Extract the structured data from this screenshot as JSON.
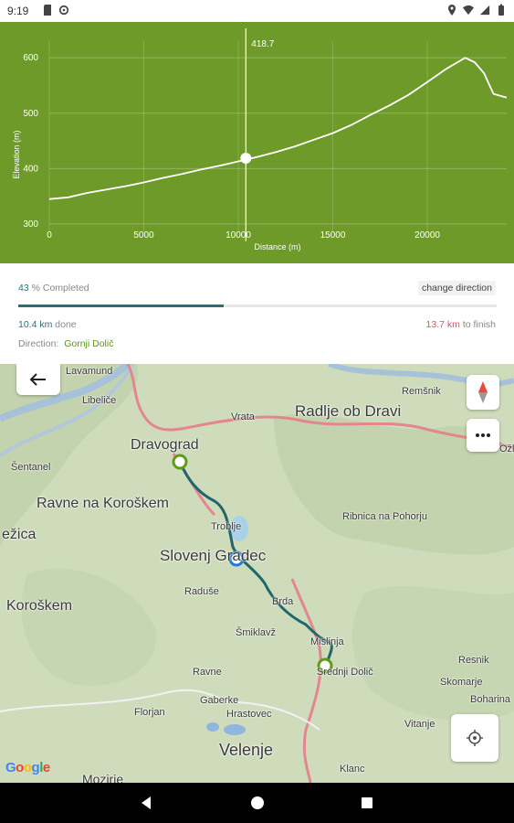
{
  "status_bar": {
    "time": "9:19"
  },
  "elevation_chart": {
    "cursor_label": "418.7",
    "ylabel": "Elevation (m)",
    "xlabel": "Distance (m)",
    "y_ticks": [
      "600",
      "500",
      "400",
      "300"
    ],
    "x_ticks": [
      "0",
      "5000",
      "10000",
      "15000",
      "20000"
    ]
  },
  "chart_data": {
    "type": "area",
    "xlabel": "Distance (m)",
    "ylabel": "Elevation (m)",
    "xlim": [
      0,
      24200
    ],
    "ylim": [
      285,
      630
    ],
    "grid": true,
    "cursor": {
      "x": 10400,
      "y": 418.7
    },
    "x": [
      0,
      1000,
      2000,
      3000,
      4000,
      5000,
      6000,
      7000,
      8000,
      9000,
      10000,
      11000,
      12000,
      13000,
      14000,
      15000,
      16000,
      17000,
      18000,
      19000,
      20000,
      21000,
      22000,
      22500,
      23000,
      23500,
      24200
    ],
    "values": [
      345,
      348,
      356,
      362,
      368,
      375,
      383,
      390,
      398,
      405,
      413,
      421,
      430,
      440,
      452,
      464,
      479,
      497,
      514,
      533,
      556,
      580,
      600,
      592,
      572,
      535,
      528
    ]
  },
  "progress": {
    "percent": "43",
    "completed_suffix": "% Completed",
    "change_direction": "change direction",
    "fraction": 0.43,
    "done_value": "10.4 km",
    "done_suffix": "done",
    "remaining_value": "13.7 km",
    "remaining_suffix": "to finish",
    "direction_label": "Direction:",
    "direction_value": "Gornji Dolič"
  },
  "map": {
    "attribution": "Google",
    "places": {
      "lavamund": "Lavamund",
      "libelice": "Libeliče",
      "vrata": "Vrata",
      "radlje": "Radlje ob Dravi",
      "remsnik": "Remšnik",
      "ozl": "Ožl",
      "dravograd": "Dravograd",
      "sentanel": "Šentanel",
      "ravne_kor": "Ravne na Koroškem",
      "ezica": "ežica",
      "troblje": "Troblje",
      "slovenj": "Slovenj Gradec",
      "ribnica": "Ribnica na Pohorju",
      "raduse": "Raduše",
      "koroskem": "Koroškem",
      "brda": "Brda",
      "smiklavz": "Šmiklavž",
      "mislinja": "Mislinja",
      "srednji": "Srednji Dolič",
      "resnik": "Resnik",
      "skomarje": "Skomarje",
      "boharina": "Boharina",
      "ravne": "Ravne",
      "gaberke": "Gaberke",
      "florjan": "Florjan",
      "hrastovec": "Hrastovec",
      "vitanje": "Vitanje",
      "velenje": "Velenje",
      "klanc": "Klanc",
      "mozirje": "Mozirje"
    }
  }
}
